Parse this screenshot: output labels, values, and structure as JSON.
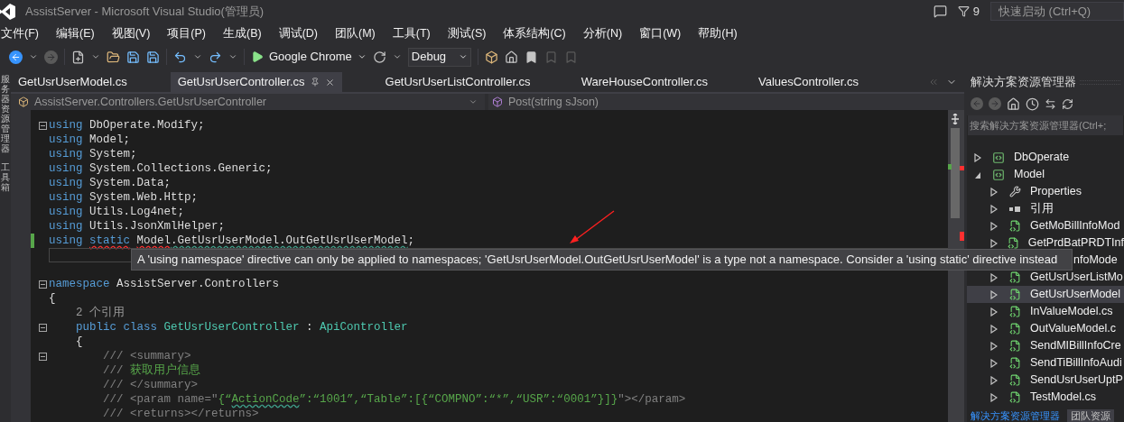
{
  "window": {
    "title": "AssistServer - Microsoft Visual Studio(管理员)",
    "notification_count": "9",
    "quick_launch": {
      "placeholder": "快速启动 (Ctrl+Q)"
    }
  },
  "menu": [
    "文件(F)",
    "编辑(E)",
    "视图(V)",
    "项目(P)",
    "生成(B)",
    "调试(D)",
    "团队(M)",
    "工具(T)",
    "测试(S)",
    "体系结构(C)",
    "分析(N)",
    "窗口(W)",
    "帮助(H)"
  ],
  "toolbar": {
    "target": "Google Chrome",
    "configuration": "Debug"
  },
  "side_strip": [
    "服务器资源管理器",
    "工具箱"
  ],
  "tabs": [
    {
      "label": "GetUsrUserModel.cs",
      "selected": false
    },
    {
      "label": "GetUsrUserController.cs",
      "selected": true
    },
    {
      "label": "GetUsrUserListController.cs",
      "selected": false
    },
    {
      "label": "WareHouseController.cs",
      "selected": false
    },
    {
      "label": "ValuesController.cs",
      "selected": false
    }
  ],
  "nav_bar": {
    "scope": "AssistServer.Controllers.GetUsrUserController",
    "member": "Post(string sJson)"
  },
  "code_lines": [
    {
      "fold": true,
      "changed": false,
      "current": false,
      "tokens": [
        {
          "text": "using",
          "kind": "kw"
        },
        {
          "text": " DbOperate.Modify;",
          "kind": "plain"
        }
      ]
    },
    {
      "fold": false,
      "changed": false,
      "current": false,
      "tokens": [
        {
          "text": "using",
          "kind": "kw"
        },
        {
          "text": " Model;",
          "kind": "plain"
        }
      ]
    },
    {
      "fold": false,
      "changed": false,
      "current": false,
      "tokens": [
        {
          "text": "using",
          "kind": "kw"
        },
        {
          "text": " System;",
          "kind": "plain"
        }
      ]
    },
    {
      "fold": false,
      "changed": false,
      "current": false,
      "tokens": [
        {
          "text": "using",
          "kind": "kw"
        },
        {
          "text": " System.Collections.Generic;",
          "kind": "plain"
        }
      ]
    },
    {
      "fold": false,
      "changed": false,
      "current": false,
      "tokens": [
        {
          "text": "using",
          "kind": "kw"
        },
        {
          "text": " System.Data;",
          "kind": "plain"
        }
      ]
    },
    {
      "fold": false,
      "changed": false,
      "current": false,
      "tokens": [
        {
          "text": "using",
          "kind": "kw"
        },
        {
          "text": " System.Web.Http;",
          "kind": "plain"
        }
      ]
    },
    {
      "fold": false,
      "changed": false,
      "current": false,
      "tokens": [
        {
          "text": "using",
          "kind": "kw"
        },
        {
          "text": " Utils.Log4net;",
          "kind": "plain"
        }
      ]
    },
    {
      "fold": false,
      "changed": false,
      "current": false,
      "tokens": [
        {
          "text": "using",
          "kind": "kw"
        },
        {
          "text": " Utils.JsonXmlHelper;",
          "kind": "plain"
        }
      ]
    },
    {
      "fold": false,
      "changed": true,
      "current": false,
      "tokens": [
        {
          "text": "using ",
          "kind": "kw"
        },
        {
          "text": "static",
          "kind": "kw",
          "error": true
        },
        {
          "text": " Model",
          "kind": "plain",
          "error": true
        },
        {
          "text": ".GetUsrUserModel.OutGetUsrUserModel",
          "kind": "plain",
          "warning": true
        },
        {
          "text": ";",
          "kind": "plain"
        }
      ]
    },
    {
      "fold": false,
      "changed": false,
      "current": true
    },
    {
      "fold": false,
      "changed": false,
      "current": false
    },
    {
      "fold": true,
      "changed": false,
      "current": false,
      "tokens": [
        {
          "text": "namespace",
          "kind": "kw"
        },
        {
          "text": " AssistServer.Controllers",
          "kind": "plain"
        }
      ]
    },
    {
      "fold": false,
      "changed": false,
      "current": false,
      "tokens": [
        {
          "text": "{",
          "kind": "plain"
        }
      ]
    },
    {
      "fold": false,
      "changed": false,
      "current": false,
      "tokens": [
        {
          "text": "    2 个引用",
          "kind": "lens"
        }
      ]
    },
    {
      "fold": true,
      "changed": false,
      "current": false,
      "tokens": [
        {
          "text": "    public class",
          "kind": "kw"
        },
        {
          "text": " GetUsrUserController",
          "kind": "type"
        },
        {
          "text": " : ",
          "kind": "plain"
        },
        {
          "text": "ApiController",
          "kind": "type"
        }
      ]
    },
    {
      "fold": false,
      "changed": false,
      "current": false,
      "tokens": [
        {
          "text": "    {",
          "kind": "plain"
        }
      ]
    },
    {
      "fold": true,
      "changed": false,
      "current": false,
      "tokens": [
        {
          "text": "        /// <summary>",
          "kind": "doc"
        }
      ]
    },
    {
      "fold": false,
      "changed": false,
      "current": false,
      "tokens": [
        {
          "text": "        ///",
          "kind": "doc"
        },
        {
          "text": " 获取用户信息",
          "kind": "comment"
        }
      ]
    },
    {
      "fold": false,
      "changed": false,
      "current": false,
      "tokens": [
        {
          "text": "        /// </summary>",
          "kind": "doc"
        }
      ]
    },
    {
      "fold": false,
      "changed": false,
      "current": false,
      "tokens": [
        {
          "text": "        /// <param name=\"",
          "kind": "doc"
        },
        {
          "text": "{“",
          "kind": "comment"
        },
        {
          "text": "ActionCode",
          "kind": "comment",
          "warning": true
        },
        {
          "text": "”:“1001”,“Table”:[{“COMPNO”:“*”,“USR”:“0001”}]}",
          "kind": "comment"
        },
        {
          "text": "\"></param>",
          "kind": "doc"
        }
      ]
    },
    {
      "fold": false,
      "changed": false,
      "current": false,
      "tokens": [
        {
          "text": "        /// <returns></returns>",
          "kind": "doc"
        }
      ]
    }
  ],
  "tooltip": "A 'using namespace' directive can only be applied to namespaces; 'GetUsrUserModel.OutGetUsrUserModel' is a type not a namespace. Consider a 'using static' directive instead",
  "solution_explorer": {
    "title": "解决方案资源管理器",
    "search": {
      "placeholder": "搜索解决方案资源管理器(Ctrl+;"
    },
    "tree": [
      {
        "label": "DbOperate",
        "kind": "project",
        "expanded": false,
        "selected": false
      },
      {
        "label": "Model",
        "kind": "project",
        "expanded": true,
        "selected": false,
        "children": [
          {
            "label": "Properties",
            "kind": "properties",
            "expanded": false,
            "selected": false
          },
          {
            "label": "引用",
            "kind": "references",
            "expanded": false,
            "selected": false
          },
          {
            "label": "GetMoBillInfoMod",
            "kind": "file",
            "expanded": false,
            "selected": false
          },
          {
            "label": "GetPrdBatPRDTInf",
            "kind": "file",
            "expanded": false,
            "selected": false
          },
          {
            "label": "nfoMode",
            "kind": "hidden",
            "selected": false
          },
          {
            "label": "GetUsrUserListMo",
            "kind": "file",
            "expanded": false,
            "selected": false
          },
          {
            "label": "GetUsrUserModel",
            "kind": "file",
            "expanded": false,
            "selected": true
          },
          {
            "label": "InValueModel.cs",
            "kind": "file",
            "expanded": false,
            "selected": false
          },
          {
            "label": "OutValueModel.c",
            "kind": "file",
            "expanded": false,
            "selected": false
          },
          {
            "label": "SendMIBillInfoCre",
            "kind": "file",
            "expanded": false,
            "selected": false
          },
          {
            "label": "SendTiBillInfoAudi",
            "kind": "file",
            "expanded": false,
            "selected": false
          },
          {
            "label": "SendUsrUserUptP",
            "kind": "file",
            "expanded": false,
            "selected": false
          },
          {
            "label": "TestModel.cs",
            "kind": "file",
            "expanded": false,
            "selected": false
          }
        ]
      }
    ],
    "bottom_tabs": [
      {
        "label": "解决方案资源管理器",
        "selected": true
      },
      {
        "label": "团队资源",
        "selected": false
      }
    ]
  }
}
